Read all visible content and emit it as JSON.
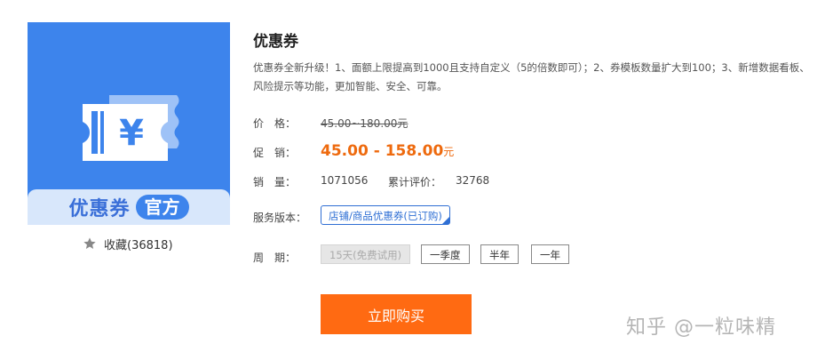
{
  "product": {
    "name": "优惠券",
    "description": "优惠券全新升级！1、面额上限提高到1000且支持自定义（5的倍数即可）；2、券模板数量扩大到100；3、新增数据看板、风险提示等功能，更加智能、安全、可靠。",
    "image": {
      "banner_title": "优惠券",
      "banner_badge": "官方",
      "symbol": "¥",
      "background_color": "#3d84ec"
    },
    "favorite": {
      "label": "收藏",
      "count": "(36818)"
    }
  },
  "pricing": {
    "price_label": "价　格：",
    "original_price": "45.00~180.00元",
    "promo_label": "促　销：",
    "promo_low": "45.00",
    "promo_separator": " - ",
    "promo_high": "158.00",
    "promo_unit": "元"
  },
  "stats": {
    "sales_label": "销　量：",
    "sales_value": "1071056",
    "reviews_label": "累计评价：",
    "reviews_value": "32768"
  },
  "edition": {
    "label": "服务版本：",
    "selected": "店铺/商品优惠券(已订购)"
  },
  "period": {
    "label": "周　期：",
    "options": [
      "15天(免费试用)",
      "一季度",
      "半年",
      "一年"
    ]
  },
  "buy_button": "立即购买",
  "watermark": "知乎 @一粒味精",
  "colors": {
    "accent_orange": "#ff6a12",
    "brand_blue": "#3d84ec",
    "link_blue": "#2f6fd4"
  }
}
